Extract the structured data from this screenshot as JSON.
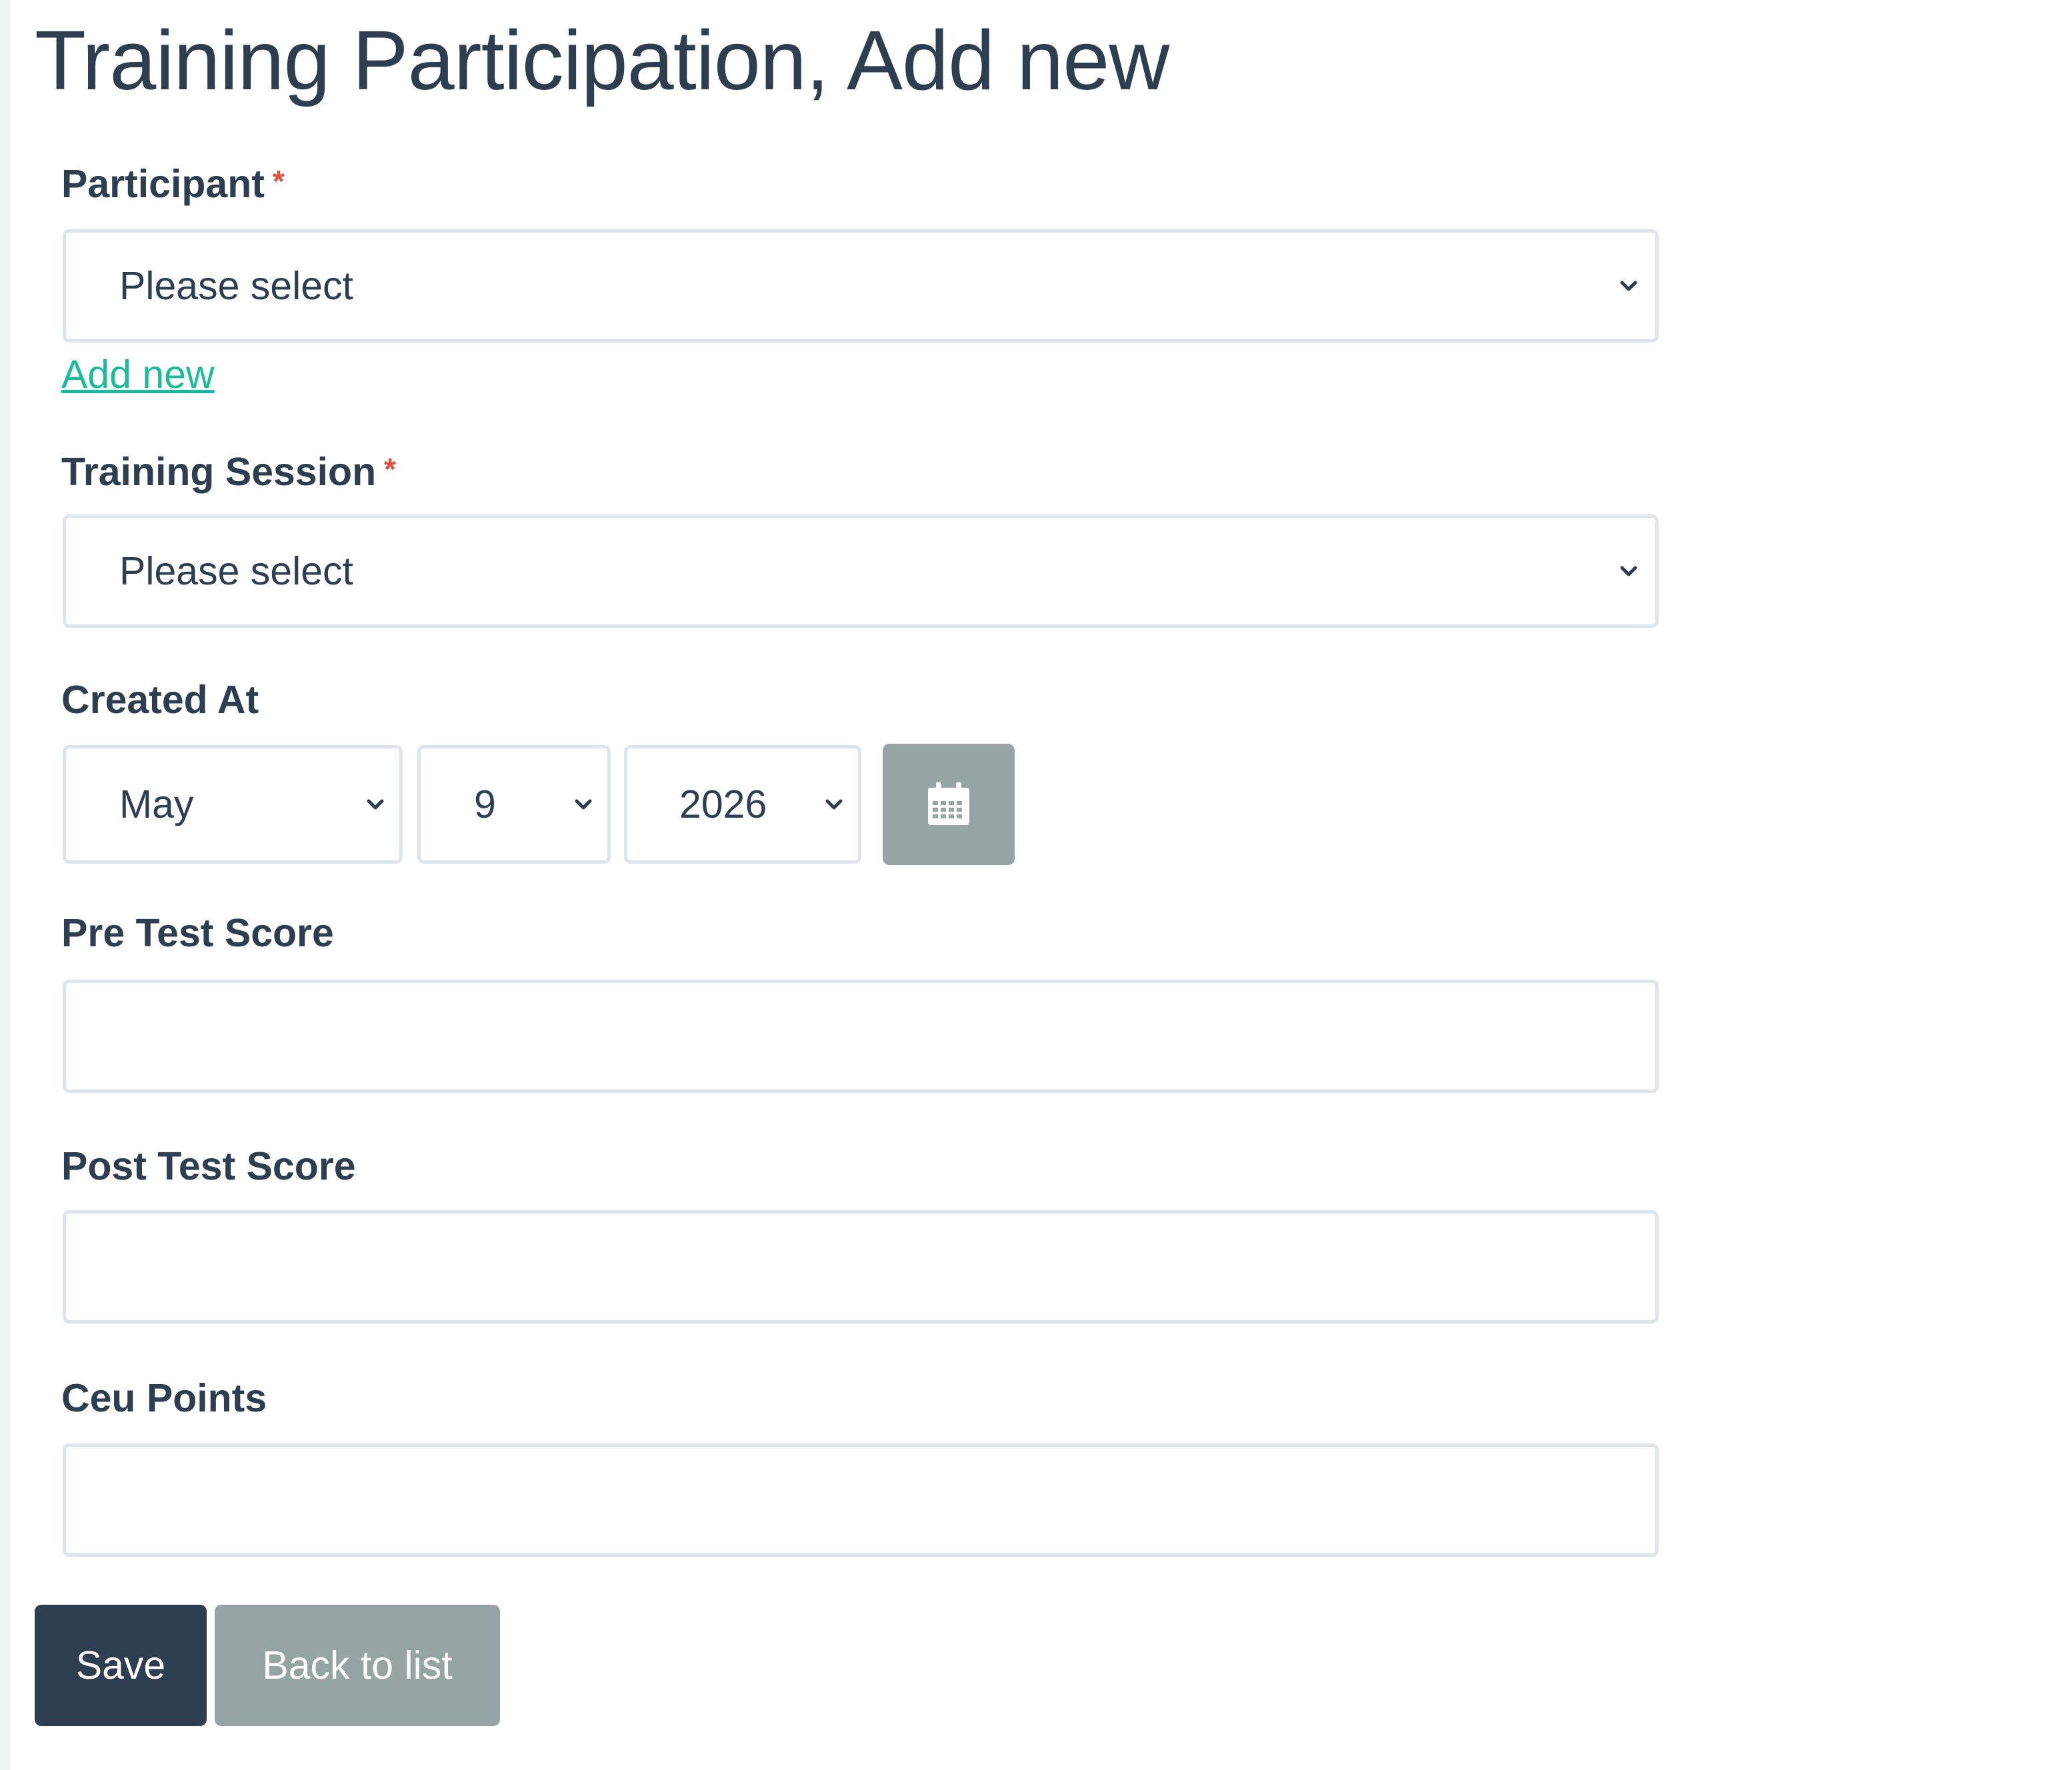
{
  "page": {
    "title": "Training Participation, Add new"
  },
  "form": {
    "participant": {
      "label": "Participant",
      "required_mark": "*",
      "selected": "Please select",
      "add_new_link": "Add new"
    },
    "training_session": {
      "label": "Training Session",
      "required_mark": "*",
      "selected": "Please select"
    },
    "created_at": {
      "label": "Created At",
      "month": "May",
      "day": "9",
      "year": "2026",
      "calendar_icon": "calendar-icon"
    },
    "pre_test_score": {
      "label": "Pre Test Score",
      "value": ""
    },
    "post_test_score": {
      "label": "Post Test Score",
      "value": ""
    },
    "ceu_points": {
      "label": "Ceu Points",
      "value": ""
    }
  },
  "actions": {
    "save_label": "Save",
    "back_label": "Back to list"
  },
  "colors": {
    "text": "#2c3e50",
    "required": "#e74c3c",
    "link": "#1abc9c",
    "primary_button": "#2c3e50",
    "secondary_button": "#95a5a6",
    "input_border": "#dce4ec"
  }
}
